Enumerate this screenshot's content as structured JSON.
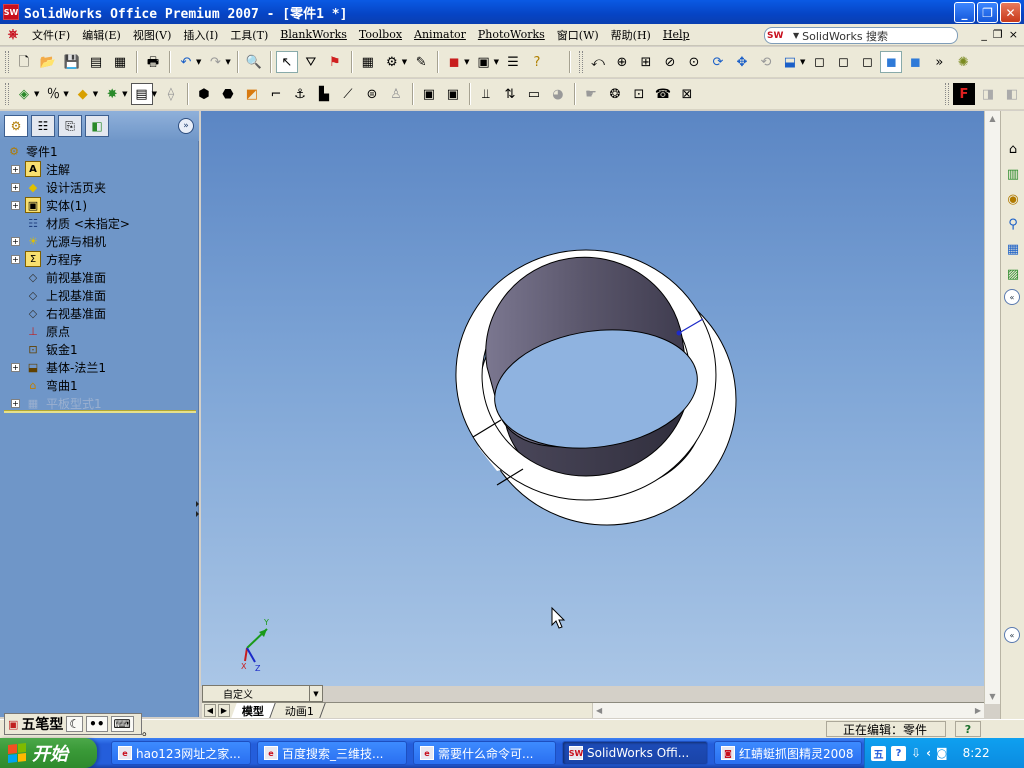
{
  "window": {
    "title": "SolidWorks Office Premium 2007 - [零件1 *]",
    "app_icon": "solidworks-icon",
    "controls": [
      "minimize-icon",
      "restore-icon",
      "close-icon"
    ]
  },
  "menubar": {
    "items": [
      "文件(F)",
      "编辑(E)",
      "视图(V)",
      "插入(I)",
      "工具(T)",
      "BlankWorks",
      "Toolbox",
      "Animator",
      "PhotoWorks",
      "窗口(W)",
      "帮助(H)",
      "Help"
    ],
    "search_placeholder": "SolidWorks 搜索",
    "doc_controls": [
      "_",
      "❐",
      "×"
    ]
  },
  "toolbar_standard": {
    "groups": [
      [
        "new-icon",
        "open-icon",
        "save-icon",
        "print-icon",
        "print-preview-icon"
      ],
      [
        "print-setup-icon"
      ],
      [
        "undo-icon",
        "redo-icon"
      ],
      [
        "zoom-to-page-icon"
      ],
      [
        "select-icon",
        "select-filter-icon",
        "rebuild-icon"
      ],
      [
        "grid-icon",
        "options-icon",
        "sketch-icon"
      ],
      [
        "3d-icon",
        "view-orient-icon",
        "properties-icon",
        "help-icon"
      ]
    ],
    "view_tools": [
      "previous-view-icon",
      "zoom-fit-icon",
      "zoom-area-icon",
      "zoom-inout-icon",
      "zoom-selection-icon",
      "rotate-icon",
      "pan-icon",
      "roll-icon",
      "standard-views-icon",
      "wireframe-icon",
      "hidden-lines-visible-icon",
      "hidden-lines-removed-icon",
      "shaded-edges-icon",
      "shaded-icon",
      "more-icon",
      "bulb-icon"
    ]
  },
  "toolbar_sheetmetal": {
    "tools": [
      "view-orientation-icon",
      "section-view-icon",
      "appearance-icon",
      "light-icon",
      "base-flange-icon",
      "convert-icon",
      "edge-flange-icon",
      "miter-flange-icon",
      "hem-icon",
      "jog-icon",
      "sketched-bend-icon",
      "cross-break-icon",
      "closed-corner-icon",
      "forming-tool-icon",
      "fold-icon",
      "unfold-icon",
      "flatten-icon",
      "no-bends-icon",
      "rip-icon",
      "insert-bends-icon",
      "extruded-cut-icon",
      "simple-hole-icon",
      "vent-icon",
      "corner-relief-icon",
      "break-corner-icon"
    ],
    "right_tools": [
      "photoworks-icon",
      "render-icon"
    ]
  },
  "feature_manager": {
    "tabs": [
      "featuremanager-tab-icon",
      "propertymanager-tab-icon",
      "configurationmanager-tab-icon",
      "dimxpert-tab-icon"
    ],
    "root_label": "零件1",
    "items": [
      {
        "label": "注解",
        "icon": "annotations-icon",
        "expandable": true
      },
      {
        "label": "设计活页夹",
        "icon": "design-binder-icon",
        "expandable": true
      },
      {
        "label": "实体(1)",
        "icon": "solid-bodies-icon",
        "expandable": true
      },
      {
        "label": "材质 <未指定>",
        "icon": "material-icon",
        "expandable": false
      },
      {
        "label": "光源与相机",
        "icon": "lights-cameras-icon",
        "expandable": true
      },
      {
        "label": "方程序",
        "icon": "equations-icon",
        "expandable": true
      },
      {
        "label": "前视基准面",
        "icon": "plane-icon",
        "expandable": false
      },
      {
        "label": "上视基准面",
        "icon": "plane-icon",
        "expandable": false
      },
      {
        "label": "右视基准面",
        "icon": "plane-icon",
        "expandable": false
      },
      {
        "label": "原点",
        "icon": "origin-icon",
        "expandable": false
      },
      {
        "label": "钣金1",
        "icon": "sheet-metal-icon",
        "expandable": false
      },
      {
        "label": "基体-法兰1",
        "icon": "base-flange-icon",
        "expandable": true
      },
      {
        "label": "弯曲1",
        "icon": "flat-bend-icon",
        "expandable": false
      },
      {
        "label": "平板型式1",
        "icon": "flat-pattern-icon",
        "expandable": true,
        "suppressed": true
      }
    ]
  },
  "graphics": {
    "colors": {
      "ring_face": "#ffffff",
      "ring_inner": "#5f5a6e",
      "edge": "#000000"
    },
    "triad": {
      "x": "X",
      "y": "Y",
      "z": "Z"
    }
  },
  "task_pane": {
    "buttons": [
      "solidworks-resources-icon",
      "design-library-icon",
      "file-explorer-icon",
      "search-icon",
      "view-palette-icon",
      "appearances-icon"
    ]
  },
  "bottom": {
    "view_selector": "自定义",
    "tabs": [
      "模型",
      "动画1"
    ]
  },
  "statusbar": {
    "ime": {
      "name": "五笔型",
      "buttons": [
        "half-moon-icon",
        "punctuation-icon",
        "keyboard-icon"
      ]
    },
    "left_text": "。",
    "right_text": "正在编辑：零件",
    "help": "?"
  },
  "taskbar": {
    "start_label": "开始",
    "tasks": [
      {
        "label": "hao123网址之家...",
        "active": false
      },
      {
        "label": "百度搜索_三维技...",
        "active": false
      },
      {
        "label": "需要什么命令可...",
        "active": false
      },
      {
        "label": "SolidWorks Offi...",
        "active": true
      },
      {
        "label": "红蜻蜓抓图精灵2008",
        "active": false
      }
    ],
    "time": "8:22"
  }
}
